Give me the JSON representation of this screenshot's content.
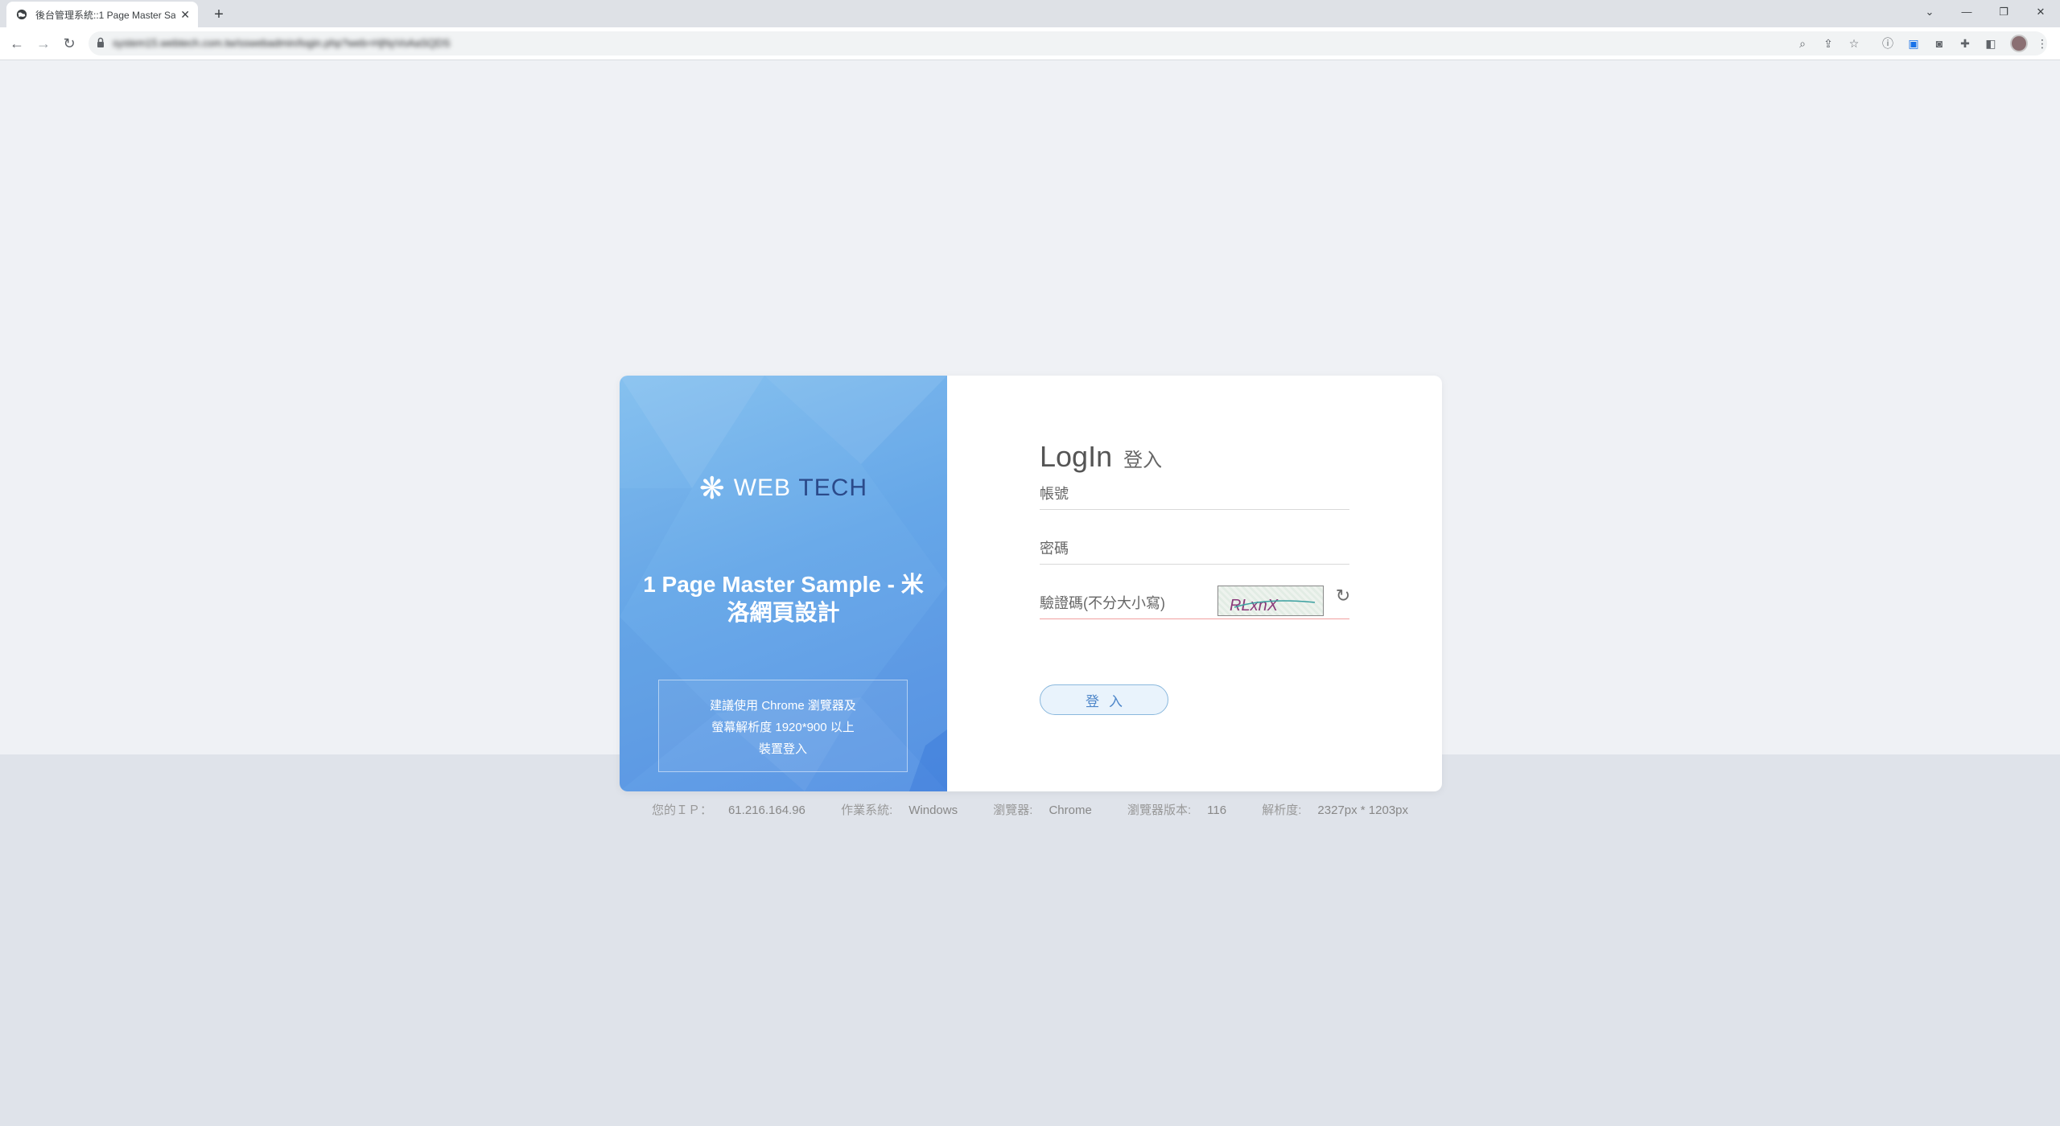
{
  "browser": {
    "tab_title": "後台管理系統::1 Page Master Sa",
    "tab_close": "✕",
    "new_tab": "+",
    "url": "system15.webtech.com.tw/sswebadmin/login.php?web=HjNyVoAaSQDS",
    "window_controls": [
      "⌄",
      "—",
      "❐",
      "✕"
    ]
  },
  "brand": {
    "mark": "❋",
    "name_part1": "WEB",
    "name_part2": "TECH"
  },
  "left_panel": {
    "title": "1 Page Master Sample - 米洛網頁設計",
    "notice_lines": [
      "建議使用 Chrome 瀏覽器及",
      "螢幕解析度 1920*900 以上",
      "裝置登入"
    ]
  },
  "login": {
    "title_en": "LogIn",
    "title_zh": "登入",
    "account_placeholder": "帳號",
    "password_placeholder": "密碼",
    "captcha_placeholder": "驗證碼(不分大小寫)",
    "captcha_text": "RLxnX",
    "refresh_icon": "refresh-icon",
    "submit_label": "登入"
  },
  "footer": {
    "ip_label": "您的ＩＰ：",
    "ip_value": "61.216.164.96",
    "os_label": "作業系統:",
    "os_value": "Windows",
    "browser_label": "瀏覽器:",
    "browser_value": "Chrome",
    "version_label": "瀏覽器版本:",
    "version_value": "116",
    "resolution_label": "解析度:",
    "resolution_value": "2327px * 1203px"
  }
}
